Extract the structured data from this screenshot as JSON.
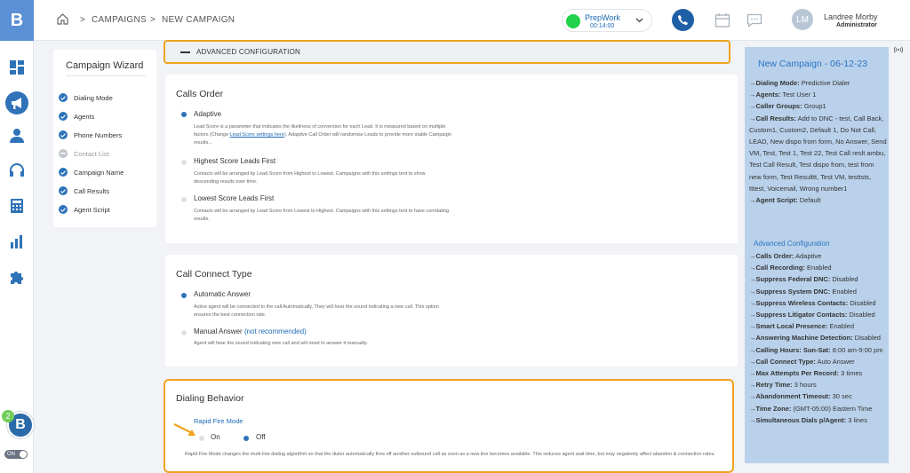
{
  "app": {
    "logo_letter": "B"
  },
  "breadcrumb": {
    "item1": "CAMPAIGNS",
    "item2": "NEW CAMPAIGN",
    "separator": ">"
  },
  "status": {
    "name": "PrepWork",
    "timer": "00:14:00",
    "color": "#21d24a"
  },
  "user": {
    "initials": "LM",
    "name": "Landree Morby",
    "role": "Administrator"
  },
  "rail": {
    "badge_count": "2",
    "toggle_label": "ON"
  },
  "wizard": {
    "title": "Campaign Wizard",
    "steps": [
      {
        "label": "Dialing Mode",
        "done": true
      },
      {
        "label": "Agents",
        "done": true
      },
      {
        "label": "Phone Numbers",
        "done": true
      },
      {
        "label": "Contact List",
        "done": false
      },
      {
        "label": "Campaign Name",
        "done": true
      },
      {
        "label": "Call Results",
        "done": true
      },
      {
        "label": "Agent Script",
        "done": true
      }
    ]
  },
  "advanced": {
    "label": "ADVANCED CONFIGURATION"
  },
  "calls_order": {
    "title": "Calls Order",
    "options": [
      {
        "label": "Adaptive",
        "selected": true,
        "desc_pre": "Lead Score is a parameter that indicates the likeliness of conversion for each Lead. It is measured based on multiple factors (Change ",
        "desc_link": "Lead Score settings here",
        "desc_post": "). Adaptive Call Order will randomise Leads to provide more stable Campaign results..."
      },
      {
        "label": "Highest Score Leads First",
        "selected": false,
        "desc": "Contacts will be arranged by Lead Score from Highest to Lowest. Campaigns with this settings tent to show descending results over time."
      },
      {
        "label": "Lowest Score Leads First",
        "selected": false,
        "desc": "Contacts will be arranged by Lead Score from Lowest to Highest. Campaigns with this settings tent to have correlating results."
      }
    ]
  },
  "call_connect": {
    "title": "Call Connect Type",
    "options": [
      {
        "label": "Automatic Answer",
        "selected": true,
        "desc": "Active agent will be connected to the call Automatically. They will hear the sound indicating a new call. This option ensures the best connection rate."
      },
      {
        "label": "Manual Answer",
        "note": "(not recommended)",
        "selected": false,
        "desc": "Agent will hear the sound indicating new call and will need to answer it manually."
      }
    ]
  },
  "dialing_behavior": {
    "title": "Dialing Behavior",
    "rapid_fire_label": "Rapid Fire Mode",
    "on_label": "On",
    "off_label": "Off",
    "selected": "Off",
    "desc": "Rapid Fire Mode changes the multi-line dialing algorithm so that the dialer automatically fires off another outbound call as soon as a new line becomes available. This reduces agent wait time, but may negatively affect abandon & connection rates."
  },
  "summary": {
    "title": "New Campaign - 06-12-23",
    "items": [
      {
        "k": "Dialing Mode:",
        "v": "Predictive Dialer"
      },
      {
        "k": "Agents:",
        "v": "Test User 1"
      },
      {
        "k": "Caller Groups:",
        "v": "Group1"
      },
      {
        "k": "Call Results:",
        "v": "Add to DNC - test, Call Back, Custom1, Custom2, Default 1, Do Not Call, LEAD, New dispo from form, No Answer, Send VM, Test, Test 1, Test 22, Test Call reslt ambu, Test Call Result, Test dispo from, test from new form, Test Resulttt, Test VM, testtsts, tttest, Voicemail, Wrong number1"
      },
      {
        "k": "Agent Script:",
        "v": "Default"
      }
    ],
    "adv_title": "Advanced Configuration",
    "adv_items": [
      {
        "k": "Calls Order:",
        "v": "Adaptive"
      },
      {
        "k": "Call Recording:",
        "v": "Enabled"
      },
      {
        "k": "Suppress Federal DNC:",
        "v": "Disabled"
      },
      {
        "k": "Suppress System DNC:",
        "v": "Enabled"
      },
      {
        "k": "Suppress Wireless Contacts:",
        "v": "Disabled"
      },
      {
        "k": "Suppress Litigator Contacts:",
        "v": "Disabled"
      },
      {
        "k": "Smart Local Presence:",
        "v": "Enabled"
      },
      {
        "k": "Answering Machine Detection:",
        "v": "Disabled"
      },
      {
        "k": "Calling Hours: Sun-Sat:",
        "v": "8:00 am-9:00 pm"
      },
      {
        "k": "Call Connect Type:",
        "v": "Auto Answer"
      },
      {
        "k": "Max Attempts Per Record:",
        "v": "3 times"
      },
      {
        "k": "Retry Time:",
        "v": "3 hours"
      },
      {
        "k": "Abandonment Timeout:",
        "v": "30 sec"
      },
      {
        "k": "Time Zone:",
        "v": "(GMT-05:00) Eastern Time"
      },
      {
        "k": "Simultaneous Dials p/Agent:",
        "v": "3 lines"
      }
    ]
  },
  "colors": {
    "accent": "#2f72b8",
    "highlight": "#f0a320",
    "panel": "#b9d1ea"
  },
  "icons": [
    "home-icon",
    "dashboard-icon",
    "megaphone-icon",
    "contacts-icon",
    "headset-icon",
    "calculator-icon",
    "bar-chart-icon",
    "puzzle-icon",
    "phone-icon",
    "calendar-icon",
    "chat-icon",
    "broadcast-icon"
  ]
}
